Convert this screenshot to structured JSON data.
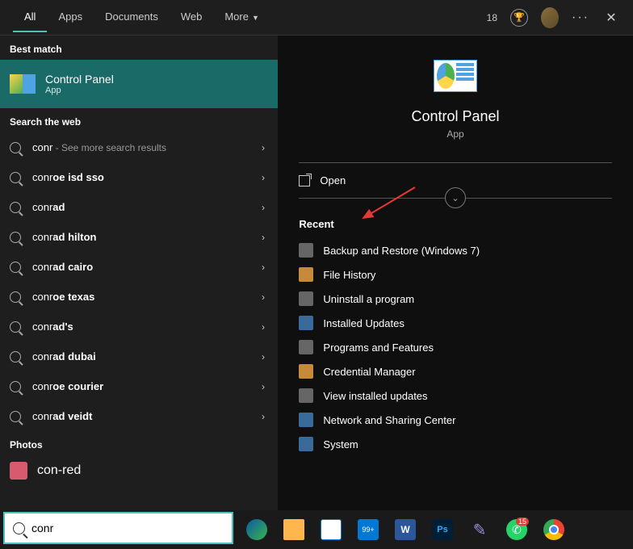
{
  "header": {
    "tabs": [
      "All",
      "Apps",
      "Documents",
      "Web",
      "More"
    ],
    "badge": "18"
  },
  "left": {
    "best_match_header": "Best match",
    "best_match": {
      "title": "Control Panel",
      "sub": "App"
    },
    "search_web_header": "Search the web",
    "items": [
      {
        "q": "conr",
        "comp": "",
        "hint": " - See more search results"
      },
      {
        "q": "conr",
        "comp": "oe isd sso",
        "hint": ""
      },
      {
        "q": "conr",
        "comp": "ad",
        "hint": ""
      },
      {
        "q": "conr",
        "comp": "ad hilton",
        "hint": ""
      },
      {
        "q": "conr",
        "comp": "ad cairo",
        "hint": ""
      },
      {
        "q": "conr",
        "comp": "oe texas",
        "hint": ""
      },
      {
        "q": "conr",
        "comp": "ad's",
        "hint": ""
      },
      {
        "q": "conr",
        "comp": "ad dubai",
        "hint": ""
      },
      {
        "q": "conr",
        "comp": "oe courier",
        "hint": ""
      },
      {
        "q": "conr",
        "comp": "ad veidt",
        "hint": ""
      }
    ],
    "photos_header": "Photos",
    "photo_item": "con-red"
  },
  "right": {
    "title": "Control Panel",
    "sub": "App",
    "open": "Open",
    "recent_header": "Recent",
    "recent": [
      "Backup and Restore (Windows 7)",
      "File History",
      "Uninstall a program",
      "Installed Updates",
      "Programs and Features",
      "Credential Manager",
      "View installed updates",
      "Network and Sharing Center",
      "System"
    ]
  },
  "taskbar": {
    "search_value": "conr",
    "mail_badge": "99+",
    "wa_badge": "15"
  }
}
